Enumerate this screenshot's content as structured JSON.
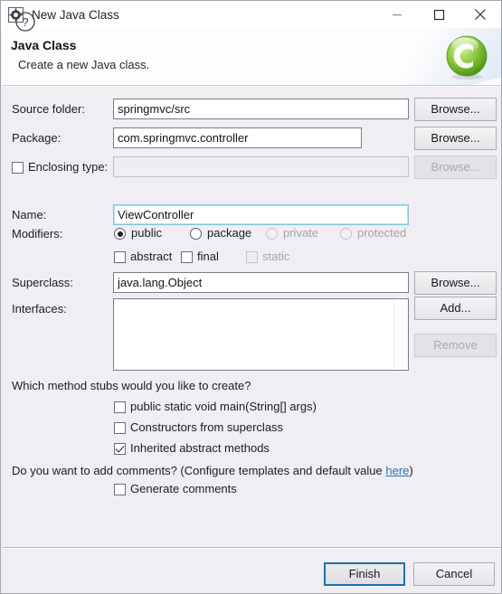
{
  "window": {
    "title": "New Java Class",
    "icon": "java-class-icon",
    "buttons": {
      "minimize": "minimize-icon",
      "maximize": "maximize-icon",
      "close": "close-icon"
    }
  },
  "header": {
    "title": "Java Class",
    "description": "Create a new Java class.",
    "icon": "green-c-wizard-icon"
  },
  "form": {
    "source_folder": {
      "label": "Source folder:",
      "value": "springmvc/src",
      "placeholder": "",
      "browse_label": "Browse..."
    },
    "package": {
      "label": "Package:",
      "value": "com.springmvc.controller",
      "placeholder": "",
      "browse_label": "Browse..."
    },
    "enclosing_type": {
      "label": "Enclosing type:",
      "checked": false,
      "value": "",
      "placeholder": "",
      "browse_label": "Browse...",
      "disabled": true
    },
    "name": {
      "label": "Name:",
      "value": "ViewController",
      "placeholder": ""
    },
    "modifiers": {
      "label": "Modifiers:",
      "radios": [
        {
          "label": "public",
          "checked": true,
          "disabled": false
        },
        {
          "label": "package",
          "checked": false,
          "disabled": false
        },
        {
          "label": "private",
          "checked": false,
          "disabled": true
        },
        {
          "label": "protected",
          "checked": false,
          "disabled": true
        }
      ],
      "checkboxes": [
        {
          "label": "abstract",
          "checked": false,
          "disabled": false
        },
        {
          "label": "final",
          "checked": false,
          "disabled": false
        },
        {
          "label": "static",
          "checked": false,
          "disabled": true
        }
      ]
    },
    "superclass": {
      "label": "Superclass:",
      "value": "java.lang.Object",
      "placeholder": "",
      "browse_label": "Browse..."
    },
    "interfaces": {
      "label": "Interfaces:",
      "items": [],
      "add_label": "Add...",
      "remove_label": "Remove",
      "remove_disabled": true
    }
  },
  "stubs": {
    "question": "Which method stubs would you like to create?",
    "options": [
      {
        "label": "public static void main(String[] args)",
        "checked": false
      },
      {
        "label": "Constructors from superclass",
        "checked": false
      },
      {
        "label": "Inherited abstract methods",
        "checked": true
      }
    ]
  },
  "comments": {
    "question_prefix": "Do you want to add comments? (Configure templates and default value ",
    "link_label": "here",
    "question_suffix": ")",
    "option": {
      "label": "Generate comments",
      "checked": false
    }
  },
  "footer": {
    "help_icon": "help-icon",
    "finish_label": "Finish",
    "cancel_label": "Cancel"
  },
  "colors": {
    "accent_blue": "#1a72ac",
    "link_blue": "#2f6fb5",
    "dialog_bg": "#f0eef2",
    "focus_border": "#7fc5dd",
    "wizard_green": "#86c63f"
  }
}
